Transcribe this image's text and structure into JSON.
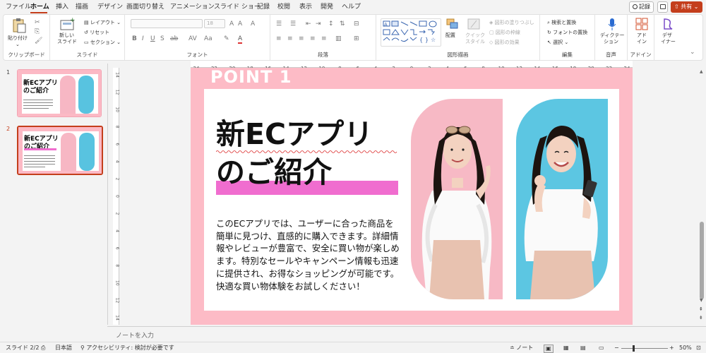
{
  "tabs": [
    "ファイル",
    "ホーム",
    "挿入",
    "描画",
    "デザイン",
    "画面切り替え",
    "アニメーション",
    "スライド ショー",
    "記録",
    "校閲",
    "表示",
    "開発",
    "ヘルプ"
  ],
  "header_buttons": {
    "record": "記録",
    "share": "共有"
  },
  "ribbon": {
    "clipboard": {
      "label": "クリップボード",
      "paste": "貼り付け"
    },
    "slides": {
      "label": "スライド",
      "new_slide": "新しい",
      "new_slide2": "スライド",
      "layout": "レイアウト",
      "reset": "リセット",
      "section": "セクション"
    },
    "font": {
      "label": "フォント",
      "size": "18"
    },
    "paragraph": {
      "label": "段落"
    },
    "drawing": {
      "label": "図形描画",
      "arrange": "配置",
      "quick_styles": "クイック",
      "quick_styles2": "スタイル",
      "fill": "図形の塗りつぶし",
      "outline": "図形の枠線",
      "effects": "図形の効果"
    },
    "editing": {
      "label": "編集",
      "find": "検索と置換",
      "replace": "フォントの置換",
      "select": "選択"
    },
    "voice": {
      "label": "音声",
      "dictate": "ディクテー",
      "dictate2": "ション"
    },
    "addins": {
      "label": "アドイン",
      "addins": "アド",
      "addins2": "イン",
      "designer": "デザ",
      "designer2": "イナー"
    }
  },
  "thumbnails": [
    {
      "num": "1",
      "title1": "新ECアプリ",
      "title2": "のご紹介"
    },
    {
      "num": "2",
      "title1": "新ECアプリ",
      "title2": "のご紹介"
    }
  ],
  "ruler": {
    "h": [
      "24",
      "22",
      "20",
      "18",
      "16",
      "14",
      "12",
      "10",
      "8",
      "6",
      "4",
      "2",
      "0",
      "2",
      "4",
      "6",
      "8",
      "10",
      "12",
      "14",
      "16",
      "18",
      "20",
      "22",
      "24"
    ],
    "v": [
      "14",
      "12",
      "10",
      "8",
      "6",
      "4",
      "2",
      "0",
      "2",
      "4",
      "6",
      "8",
      "10",
      "12",
      "14"
    ]
  },
  "slide": {
    "point_label": "POINT 1",
    "title_line1": "新ECアプリ",
    "title_line2": "のご紹介",
    "body": "このECアプリでは、ユーザーに合った商品を簡単に見つけ、直感的に購入できます。詳細情報やレビューが豊富で、安全に買い物が楽しめます。特別なセールやキャンペーン情報も迅速に提供され、お得なショッピングが可能です。快適な買い物体験をお試しください！"
  },
  "notes_placeholder": "ノートを入力",
  "status": {
    "slide": "スライド 2/2",
    "language": "日本語",
    "accessibility": "アクセシビリティ: 検討が必要です",
    "notes": "ノート",
    "zoom": "50%"
  },
  "colors": {
    "accent": "#c43e1c",
    "slide_bg": "#fdbbc6",
    "highlight": "#f06dcf",
    "photo_pink": "#f7b9c5",
    "photo_blue": "#5cc6e2"
  }
}
